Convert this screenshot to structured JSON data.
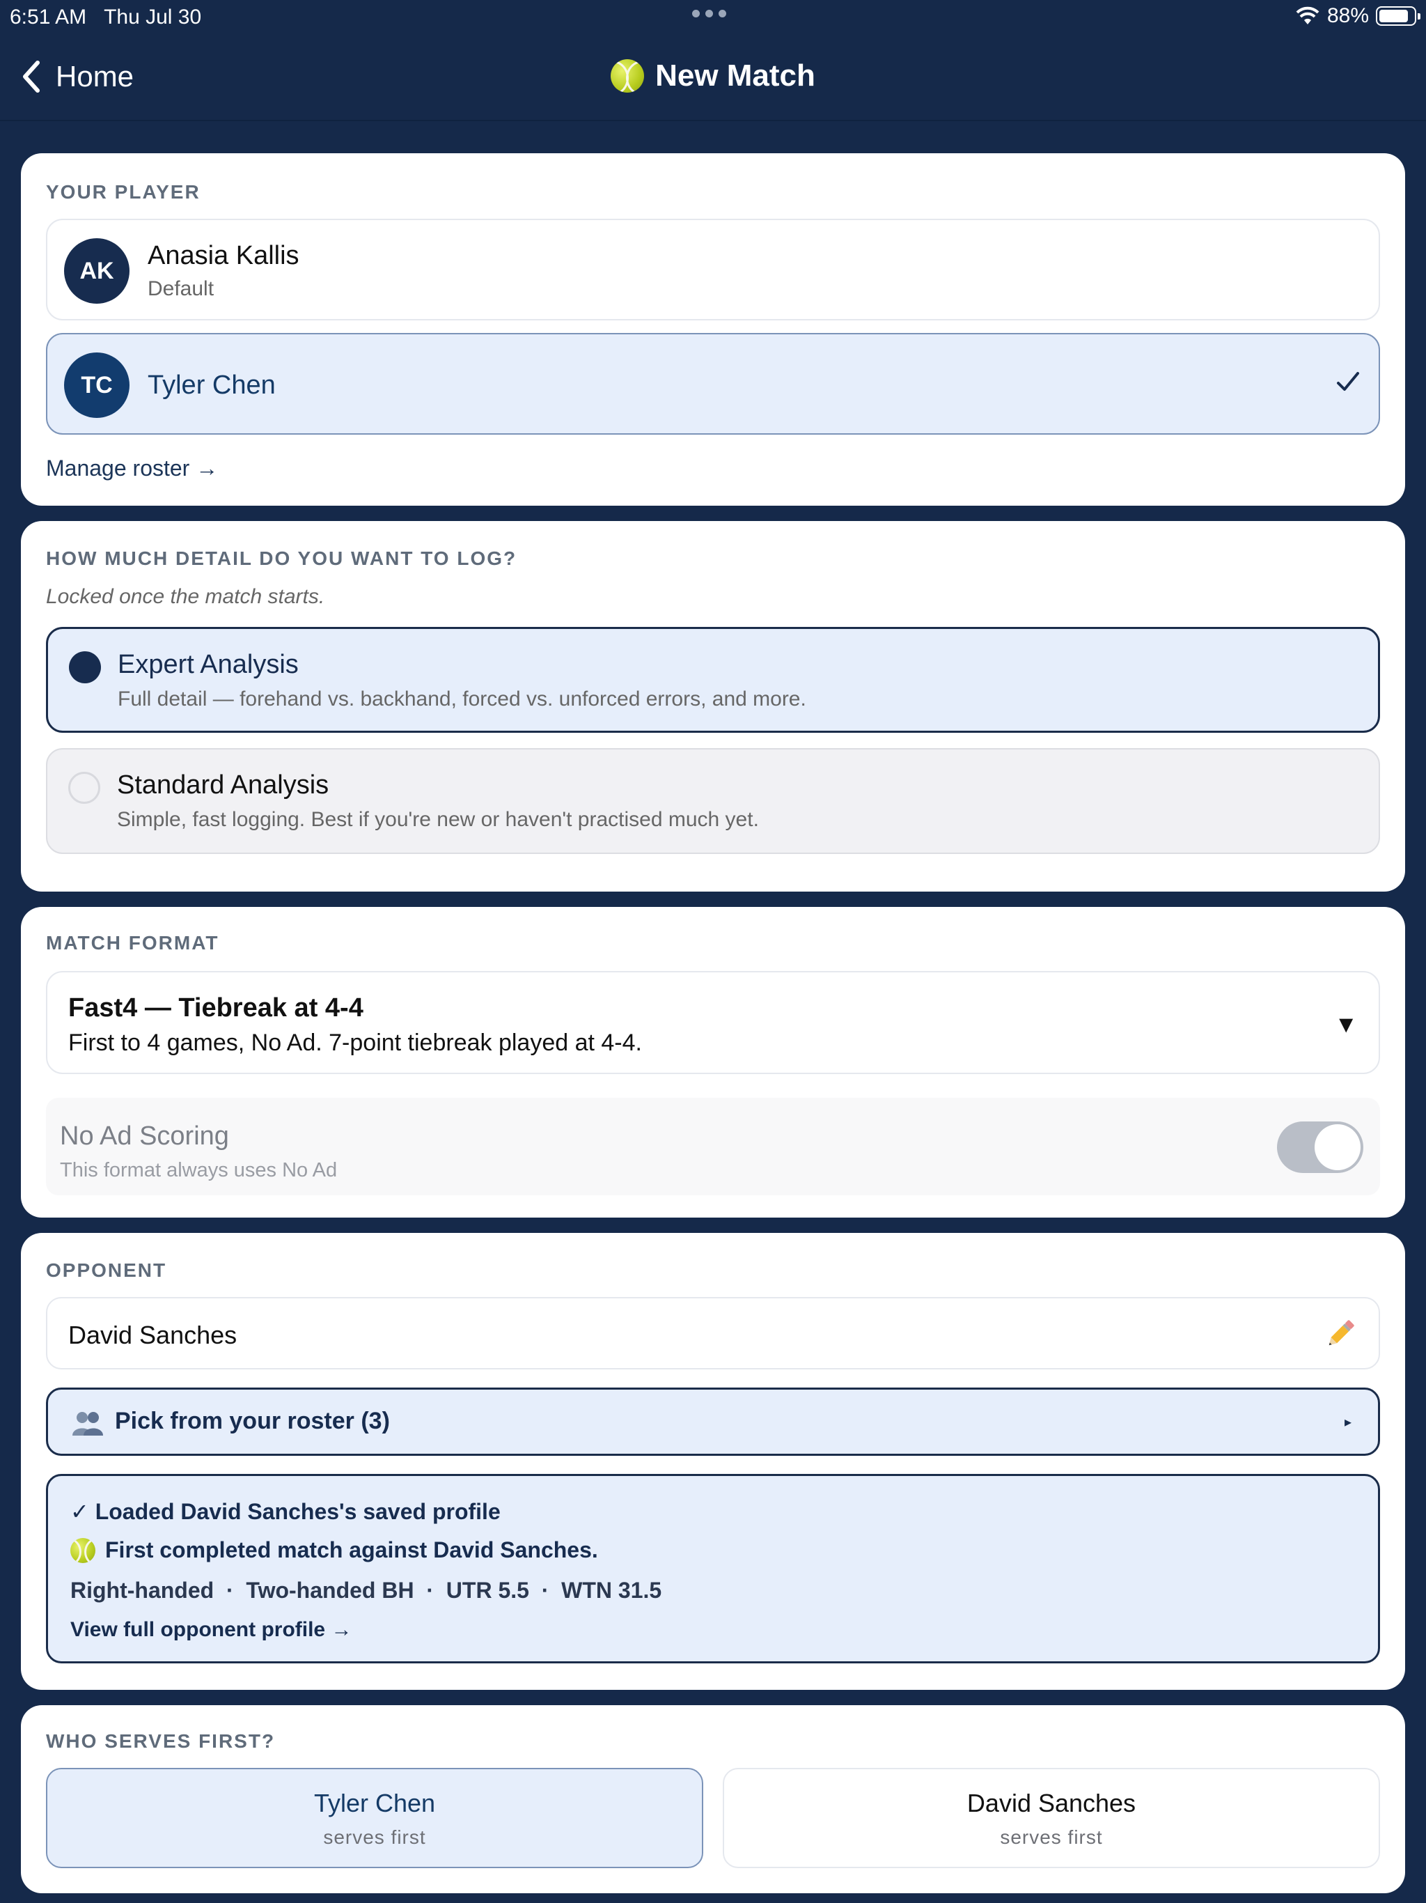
{
  "status": {
    "time": "6:51 AM",
    "date": "Thu Jul 30",
    "battery": "88%"
  },
  "nav": {
    "back_label": "Home",
    "title": "New Match"
  },
  "your_player": {
    "label": "YOUR PLAYER",
    "players": [
      {
        "initials": "AK",
        "name": "Anasia Kallis",
        "sub": "Default",
        "selected": false
      },
      {
        "initials": "TC",
        "name": "Tyler Chen",
        "selected": true
      }
    ],
    "manage_link": "Manage roster →"
  },
  "detail": {
    "label": "HOW MUCH DETAIL DO YOU WANT TO LOG?",
    "note": "Locked once the match starts.",
    "options": [
      {
        "title": "Expert Analysis",
        "desc": "Full detail — forehand vs. backhand, forced vs. unforced errors, and more.",
        "selected": true
      },
      {
        "title": "Standard Analysis",
        "desc": "Simple, fast logging. Best if you're new or haven't practised much yet.",
        "selected": false
      }
    ]
  },
  "format": {
    "label": "MATCH FORMAT",
    "title": "Fast4 — Tiebreak at 4-4",
    "desc": "First to 4 games, No Ad. 7-point tiebreak played at 4-4.",
    "caret": "▼",
    "no_ad": {
      "title": "No Ad Scoring",
      "sub": "This format always uses No Ad",
      "on": true
    }
  },
  "opponent": {
    "label": "OPPONENT",
    "name": "David Sanches",
    "pick_label": "Pick from your roster (3)",
    "pick_caret": "▸",
    "info": {
      "loaded": "✓ Loaded David Sanches's saved profile",
      "first_match": "First completed match against David Sanches.",
      "stats": "Right-handed  ·  Two-handed BH  ·  UTR 5.5  ·  WTN 31.5",
      "view_link": "View full opponent profile →"
    }
  },
  "serve": {
    "label": "WHO SERVES FIRST?",
    "options": [
      {
        "name": "Tyler Chen",
        "sub": "serves first",
        "selected": true
      },
      {
        "name": "David Sanches",
        "sub": "serves first",
        "selected": false
      }
    ]
  }
}
